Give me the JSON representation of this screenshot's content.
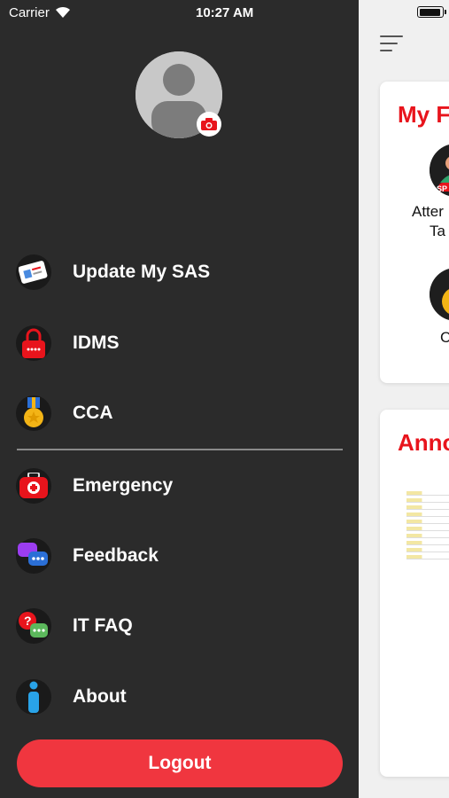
{
  "status_bar": {
    "carrier": "Carrier",
    "time": "10:27 AM"
  },
  "drawer": {
    "menu_items": [
      {
        "label": "Update My SAS",
        "icon": "id-card-icon"
      },
      {
        "label": "IDMS",
        "icon": "lock-icon"
      },
      {
        "label": "CCA",
        "icon": "medal-icon"
      },
      {
        "label": "Emergency",
        "icon": "first-aid-kit-icon"
      },
      {
        "label": "Feedback",
        "icon": "chat-bubbles-icon"
      },
      {
        "label": "IT FAQ",
        "icon": "question-chat-icon"
      },
      {
        "label": "About",
        "icon": "info-icon"
      }
    ],
    "logout_label": "Logout"
  },
  "main": {
    "card1_title": "My F",
    "function_1_label_line1": "Atter",
    "function_1_label_line2": "Ta",
    "function_1_badge": "SP",
    "function_2_label": "C",
    "card2_title": "Anno"
  },
  "colors": {
    "drawer_bg": "#2b2b2b",
    "accent_red": "#e8141c",
    "logout_red": "#f0363f",
    "text_white": "#ffffff"
  }
}
